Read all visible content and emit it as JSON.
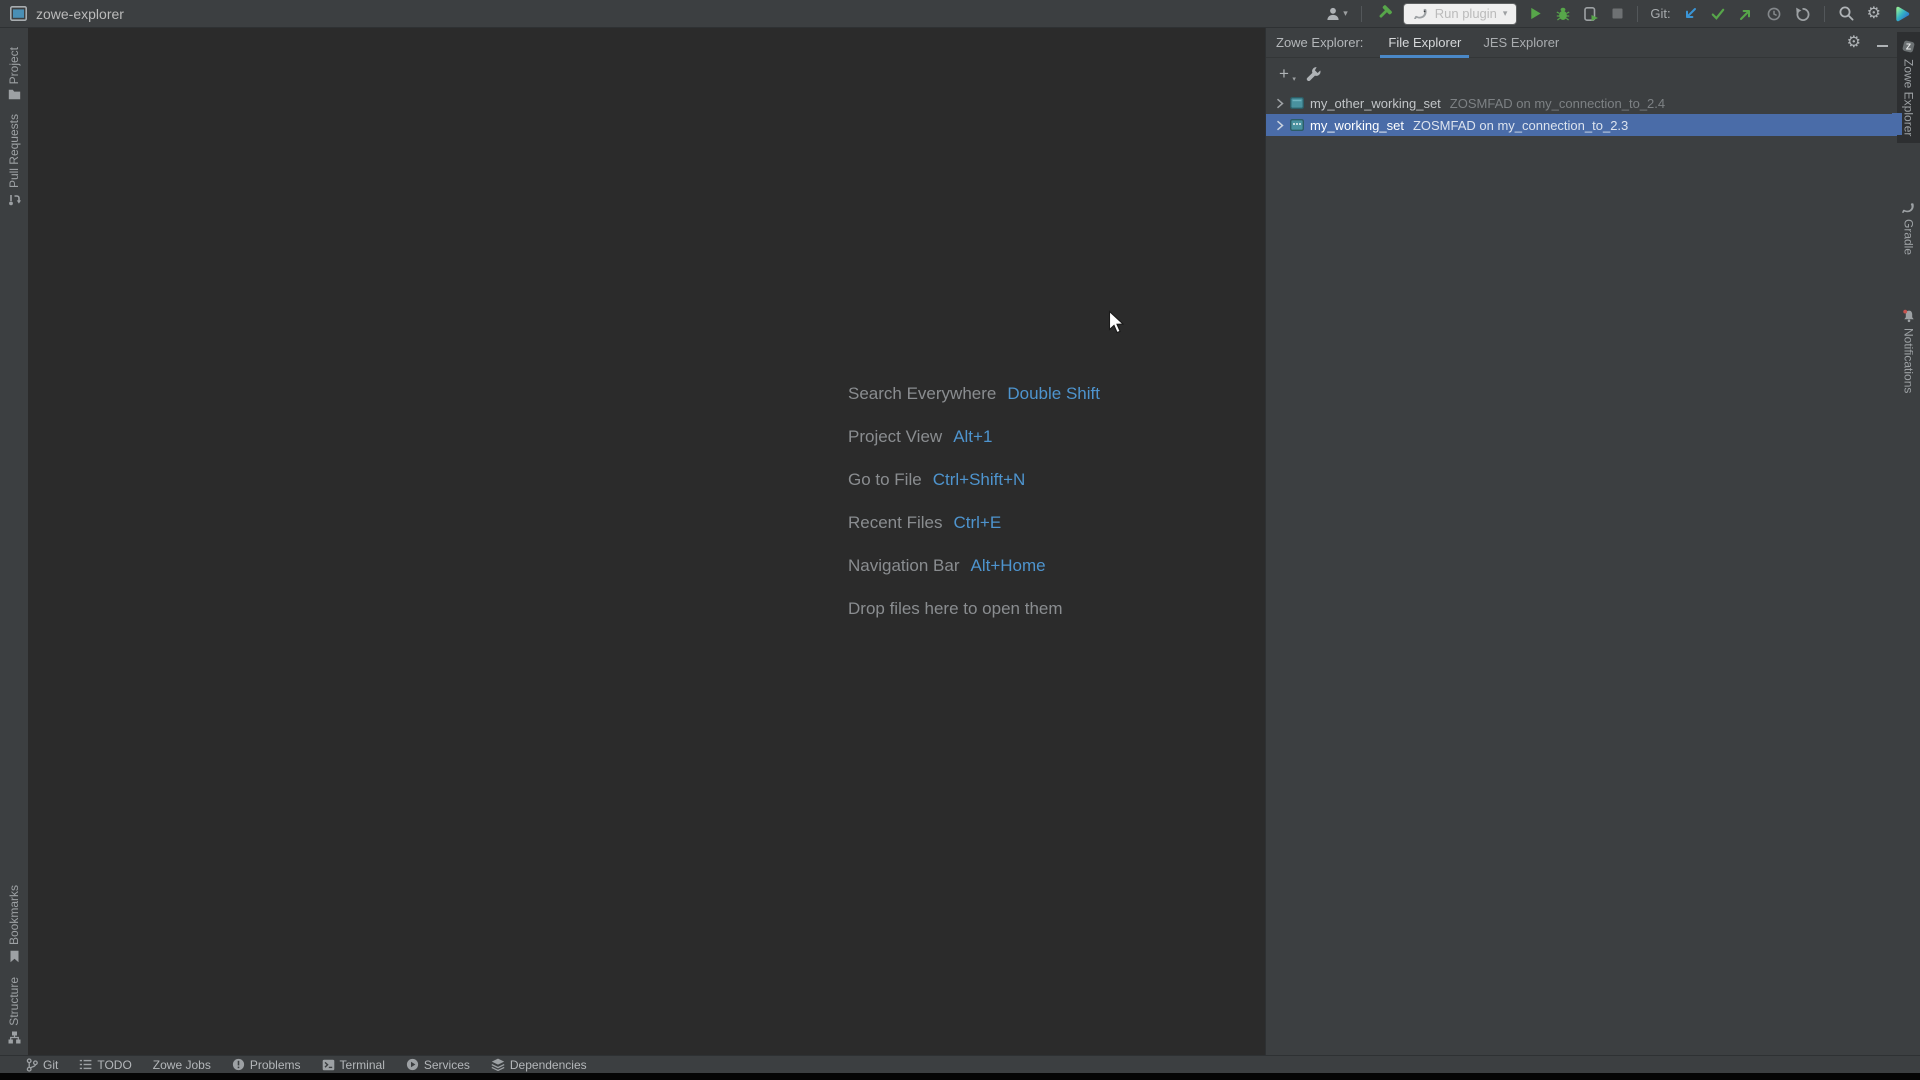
{
  "titlebar": {
    "title": "zowe-explorer",
    "run_config": "Run plugin",
    "git_label": "Git:"
  },
  "icons": {
    "gear": "⚙",
    "plus": "+",
    "caret": "▾"
  },
  "left_stripe": {
    "items": [
      {
        "label": "Project"
      },
      {
        "label": "Pull Requests"
      },
      {
        "label": "Bookmarks"
      },
      {
        "label": "Structure"
      }
    ]
  },
  "right_stripe": {
    "items": [
      {
        "label": "Zowe Explorer",
        "active": true
      },
      {
        "label": "Gradle"
      },
      {
        "label": "Notifications"
      }
    ]
  },
  "editor": {
    "shortcuts": [
      {
        "label": "Search Everywhere",
        "keys": "Double Shift"
      },
      {
        "label": "Project View",
        "keys": "Alt+1"
      },
      {
        "label": "Go to File",
        "keys": "Ctrl+Shift+N"
      },
      {
        "label": "Recent Files",
        "keys": "Ctrl+E"
      },
      {
        "label": "Navigation Bar",
        "keys": "Alt+Home"
      },
      {
        "label": "Drop files here to open them",
        "keys": ""
      }
    ]
  },
  "zowe_panel": {
    "header_label": "Zowe Explorer:",
    "tabs": [
      {
        "label": "File Explorer",
        "active": true
      },
      {
        "label": "JES Explorer",
        "active": false
      }
    ],
    "tree": [
      {
        "name": "my_other_working_set",
        "detail": "ZOSMFAD on my_connection_to_2.4",
        "selected": false
      },
      {
        "name": "my_working_set",
        "detail": "ZOSMFAD on my_connection_to_2.3",
        "selected": true
      }
    ]
  },
  "bottom_bar": {
    "items": [
      {
        "label": "Git"
      },
      {
        "label": "TODO"
      },
      {
        "label": "Zowe Jobs"
      },
      {
        "label": "Problems"
      },
      {
        "label": "Terminal"
      },
      {
        "label": "Services"
      },
      {
        "label": "Dependencies"
      }
    ]
  },
  "colors": {
    "panel_bg": "#3C3F41",
    "editor_bg": "#2B2B2B",
    "selection": "#4A6CA8",
    "tab_underline": "#4A88C7",
    "shortcut_key_blue": "#4E94CE",
    "green": "#57A64A",
    "git_update_blue": "#3A95D6"
  }
}
